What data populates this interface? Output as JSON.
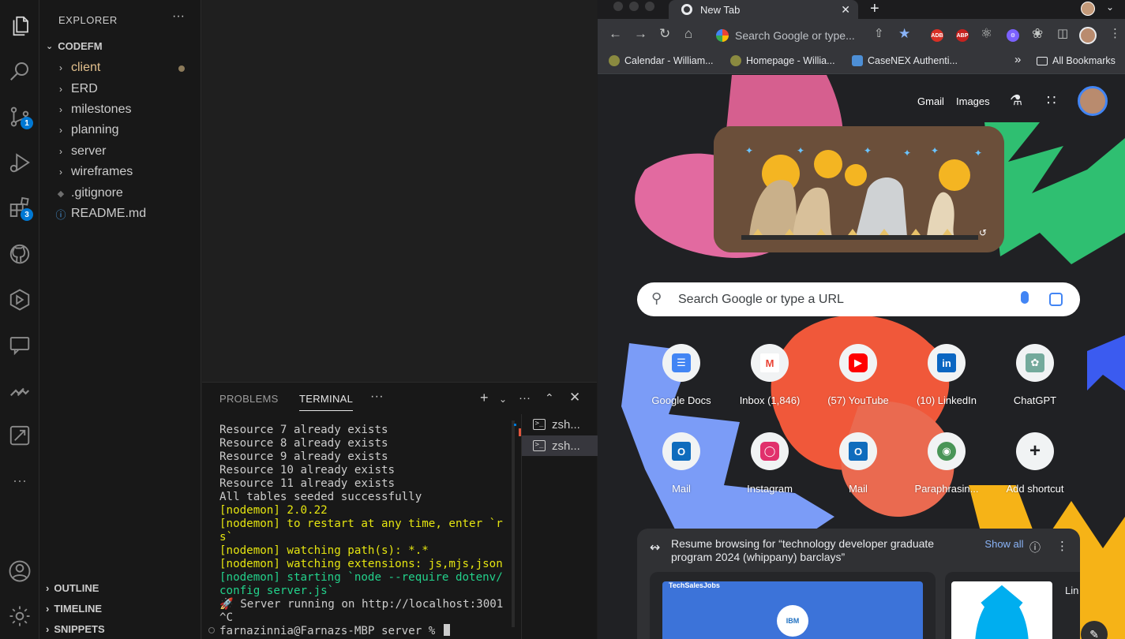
{
  "vscode": {
    "activity": {
      "source_control_badge": "1",
      "extensions_badge": "3"
    },
    "sidebar": {
      "header": "EXPLORER",
      "more": "···",
      "folder": "CODEFM",
      "items": [
        {
          "label": "client",
          "type": "folder",
          "modified": true
        },
        {
          "label": "ERD",
          "type": "folder"
        },
        {
          "label": "milestones",
          "type": "folder"
        },
        {
          "label": "planning",
          "type": "folder"
        },
        {
          "label": "server",
          "type": "folder"
        },
        {
          "label": "wireframes",
          "type": "folder"
        },
        {
          "label": ".gitignore",
          "type": "file"
        },
        {
          "label": "README.md",
          "type": "file"
        }
      ],
      "sections": [
        "OUTLINE",
        "TIMELINE",
        "SNIPPETS"
      ]
    },
    "panel": {
      "tabs": [
        "PROBLEMS",
        "TERMINAL"
      ],
      "tab_more": "···",
      "terminal_lines": [
        {
          "text": "Resource 7 already exists",
          "color": "default"
        },
        {
          "text": "Resource 8 already exists",
          "color": "default"
        },
        {
          "text": "Resource 9 already exists",
          "color": "default"
        },
        {
          "text": "Resource 10 already exists",
          "color": "default"
        },
        {
          "text": "Resource 11 already exists",
          "color": "default"
        },
        {
          "text": "All tables seeded successfully",
          "color": "default"
        },
        {
          "text": "[nodemon] 2.0.22",
          "color": "yellow"
        },
        {
          "text": "[nodemon] to restart at any time, enter `r",
          "color": "yellow"
        },
        {
          "text": "s`",
          "color": "yellow"
        },
        {
          "text": "[nodemon] watching path(s): *.*",
          "color": "yellow"
        },
        {
          "text": "[nodemon] watching extensions: js,mjs,json",
          "color": "yellow"
        },
        {
          "text": "[nodemon] starting `node --require dotenv/",
          "color": "green"
        },
        {
          "text": "config server.js`",
          "color": "green"
        },
        {
          "text": "🚀 Server running on http://localhost:3001",
          "color": "default"
        },
        {
          "text": "^C",
          "color": "default"
        },
        {
          "text": "farnazinnia@Farnazs-MBP server % ",
          "color": "default"
        }
      ],
      "terminals": [
        "zsh...",
        "zsh..."
      ]
    }
  },
  "chrome": {
    "tab_title": "New Tab",
    "omnibox_placeholder": "Search Google or type...",
    "bookmarks": [
      "Calendar - William...",
      "Homepage - Willia...",
      "CaseNEX Authenti..."
    ],
    "bookmarks_overflow": "»",
    "all_bookmarks": "All Bookmarks",
    "ntp": {
      "gmail": "Gmail",
      "images": "Images",
      "search_placeholder": "Search Google or type a URL",
      "shortcuts": [
        {
          "label": "Google Docs",
          "icon": "google-docs-icon"
        },
        {
          "label": "Inbox (1,846)",
          "icon": "gmail-icon"
        },
        {
          "label": "(57) YouTube",
          "icon": "youtube-icon"
        },
        {
          "label": "(10) LinkedIn",
          "icon": "linkedin-icon"
        },
        {
          "label": "ChatGPT",
          "icon": "chatgpt-icon"
        },
        {
          "label": "Mail",
          "icon": "outlook-icon"
        },
        {
          "label": "Instagram",
          "icon": "instagram-icon"
        },
        {
          "label": "Mail",
          "icon": "outlook-icon"
        },
        {
          "label": "Paraphrasin...",
          "icon": "quillbot-icon"
        },
        {
          "label": "Add shortcut",
          "icon": "plus-icon"
        }
      ],
      "resume": {
        "title": "Resume browsing for “technology developer graduate program 2024 (whippany) barclays”",
        "show_all": "Show all",
        "card_label_partial": "Lin",
        "ibm_text": "IBM",
        "techsales_text": "TechSalesJobs"
      }
    }
  },
  "colors": {
    "vscode_accent": "#0078d4",
    "terminal_yellow": "#e5e510",
    "terminal_green": "#23d18b",
    "chrome_link": "#8ab4f8"
  }
}
